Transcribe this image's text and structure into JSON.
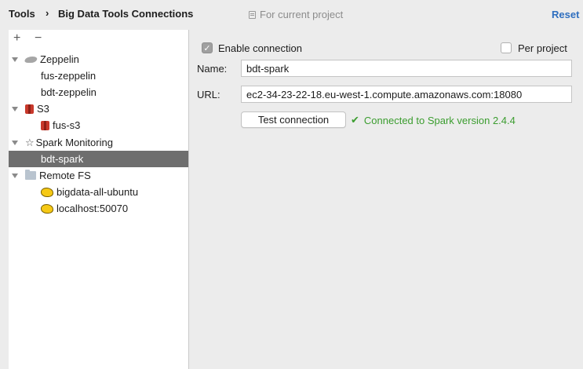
{
  "breadcrumb": {
    "root": "Tools",
    "separator": "›",
    "current": "Big Data Tools Connections"
  },
  "scope_hint": "For current project",
  "reset_label": "Reset",
  "toolbar": {
    "add": "+",
    "remove": "−"
  },
  "tree": {
    "zeppelin": {
      "label": "Zeppelin",
      "items": [
        "fus-zeppelin",
        "bdt-zeppelin"
      ]
    },
    "s3": {
      "label": "S3",
      "items": [
        "fus-s3"
      ]
    },
    "spark": {
      "label": "Spark Monitoring",
      "items": [
        "bdt-spark"
      ]
    },
    "remote": {
      "label": "Remote FS",
      "items": [
        "bigdata-all-ubuntu",
        "localhost:50070"
      ]
    },
    "selected": "bdt-spark"
  },
  "form": {
    "enable_label": "Enable connection",
    "enable_checked": true,
    "per_project_label": "Per project",
    "per_project_checked": false,
    "name_label": "Name:",
    "name_value": "bdt-spark",
    "url_label": "URL:",
    "url_value": "ec2-34-23-22-18.eu-west-1.compute.amazonaws.com:18080",
    "test_button": "Test connection",
    "status_text": "Connected to Spark version 2.4.4"
  },
  "colors": {
    "link": "#2f6fbf",
    "success": "#3b9d2f",
    "selection": "#6e6e6e"
  }
}
